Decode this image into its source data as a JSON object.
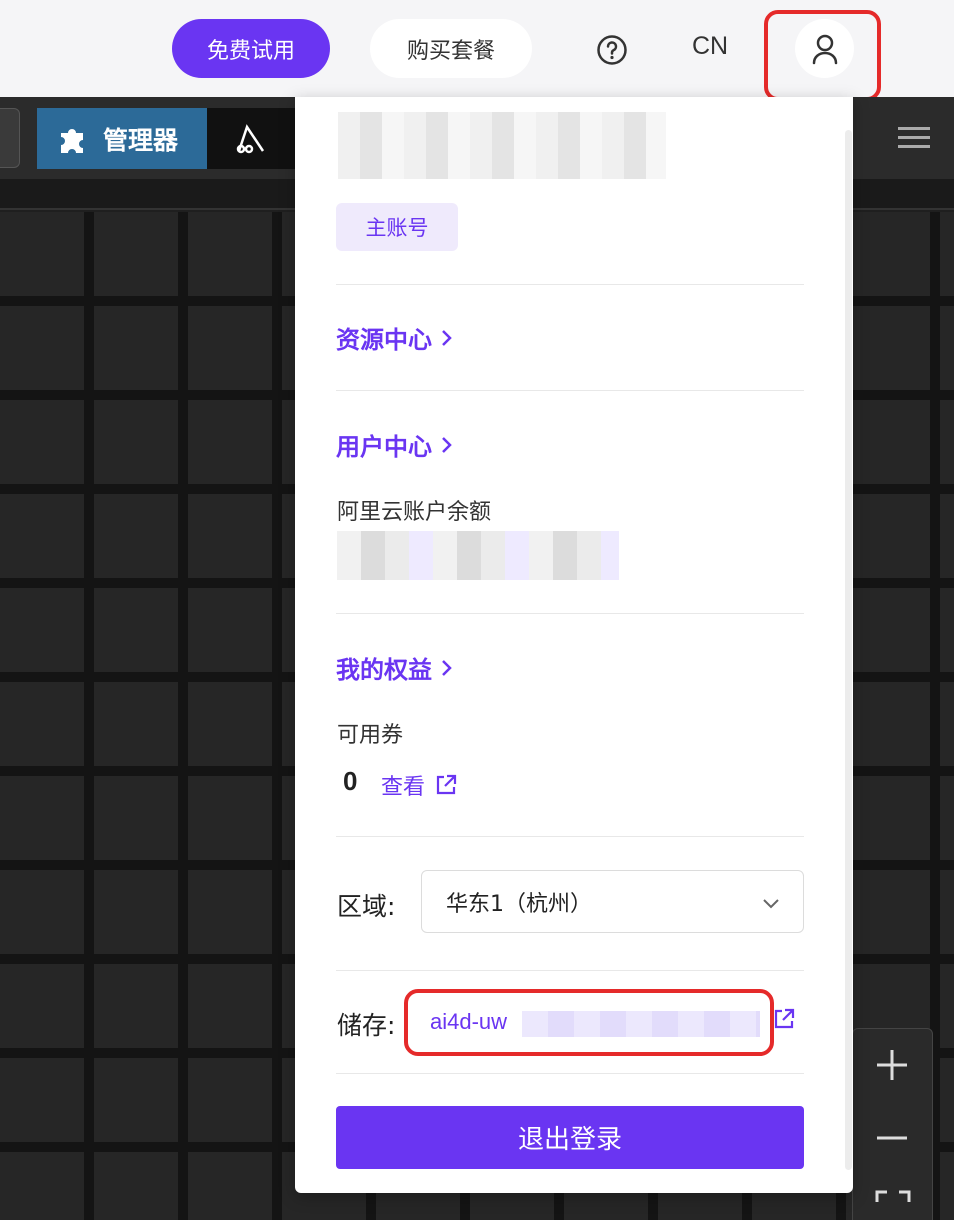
{
  "header": {
    "trial_label": "免费试用",
    "buy_label": "购买套餐",
    "help_icon": "question-circle-icon",
    "language": "CN",
    "user_icon": "user-icon"
  },
  "app": {
    "manager_tab": "管理器",
    "manager_icon": "puzzle-icon",
    "menu_icon": "hamburger-icon"
  },
  "account": {
    "role_badge": "主账号"
  },
  "menu": {
    "resource_center": "资源中心",
    "user_center": "用户中心",
    "balance_label": "阿里云账户余额",
    "benefits": "我的权益",
    "coupon_label": "可用券",
    "coupon_count": "0",
    "coupon_view": "查看",
    "region_label": "区域:",
    "region_value": "华东1（杭州）",
    "storage_label": "储存:",
    "storage_value": "ai4d-uw",
    "logout": "退出登录"
  },
  "colors": {
    "accent": "#6a35f2",
    "highlight": "#e52a2a"
  }
}
